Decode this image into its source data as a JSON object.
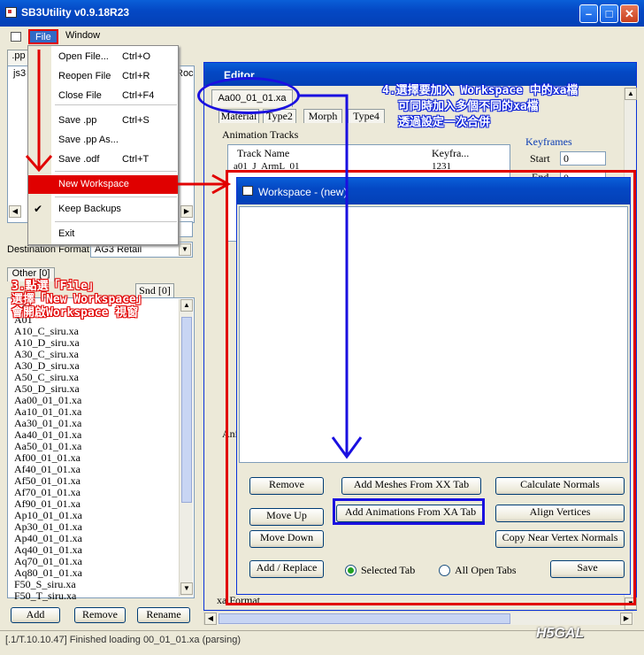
{
  "window": {
    "title": "SB3Utility v0.9.18R23"
  },
  "menubar": {
    "file": "File",
    "window": "Window"
  },
  "file_menu": {
    "items": [
      {
        "label": "Open File...",
        "shortcut": "Ctrl+O"
      },
      {
        "label": "Reopen File",
        "shortcut": "Ctrl+R"
      },
      {
        "label": "Close File",
        "shortcut": "Ctrl+F4"
      },
      {
        "label": "Save .pp",
        "shortcut": "Ctrl+S"
      },
      {
        "label": "Save .pp As...",
        "shortcut": ""
      },
      {
        "label": "Save .odf",
        "shortcut": "Ctrl+T"
      },
      {
        "label": "New Workspace",
        "shortcut": ""
      },
      {
        "label": "Keep Backups",
        "shortcut": ""
      },
      {
        "label": "Exit",
        "shortcut": ""
      }
    ]
  },
  "left_panel": {
    "top_tab": ".pp",
    "top_text": "js3",
    "side_text": "Roc",
    "dest_format_label": "Destination Format",
    "dest_format_value": "AG3 Retail",
    "tabs": [
      "Other [0]",
      "Snd [0]"
    ],
    "files": [
      "A00",
      "A01",
      "A10_C_siru.xa",
      "A10_D_siru.xa",
      "A30_C_siru.xa",
      "A30_D_siru.xa",
      "A50_C_siru.xa",
      "A50_D_siru.xa",
      "Aa00_01_01.xa",
      "Aa10_01_01.xa",
      "Aa30_01_01.xa",
      "Aa40_01_01.xa",
      "Aa50_01_01.xa",
      "Af00_01_01.xa",
      "Af40_01_01.xa",
      "Af50_01_01.xa",
      "Af70_01_01.xa",
      "Af90_01_01.xa",
      "Ap10_01_01.xa",
      "Ap30_01_01.xa",
      "Ap40_01_01.xa",
      "Aq40_01_01.xa",
      "Aq70_01_01.xa",
      "Aq80_01_01.xa",
      "F50_S_siru.xa",
      "F50_T_siru.xa"
    ],
    "buttons": {
      "add": "Add",
      "remove": "Remove",
      "rename": "Rename"
    },
    "status": "[.1/T.10.10.47] Finished loading  00_01_01.xa  (parsing)"
  },
  "editor": {
    "title": "Editor",
    "file_tab": "Aa00_01_01.xa",
    "tabs": [
      "Material",
      "Type2",
      "Morph",
      "Type4"
    ],
    "anim_tracks_label": "Animation Tracks",
    "col_track": "Track Name",
    "col_keyframes": "Keyfra...",
    "keyframes_label": "Keyframes",
    "start_label": "Start",
    "start_value": "0",
    "end_label": "End",
    "end_value": "0",
    "row1": "a01_J_ArmL_01",
    "row1_val": "1231",
    "xa_format_label": "xa Format",
    "ani_label": "Ani"
  },
  "workspace": {
    "title": "Workspace - (new)",
    "buttons": {
      "remove": "Remove",
      "move_up": "Move Up",
      "move_down": "Move Down",
      "add_replace": "Add / Replace",
      "add_meshes": "Add Meshes From XX Tab",
      "add_animations": "Add Animations From XA Tab",
      "calc_normals": "Calculate Normals",
      "align_vertices": "Align Vertices",
      "copy_normals": "Copy Near Vertex Normals",
      "save": "Save"
    },
    "radio_selected": "Selected Tab",
    "radio_all": "All Open Tabs"
  },
  "annotations": {
    "step3": [
      "3.點選「File」",
      "選擇「New Workspace」",
      "會開啟Workspace 視窗"
    ],
    "step4": [
      "4.選擇要加入 Workspace 中的xa檔",
      "可同時加入多個不同的xa檔",
      "透過設定一次合併"
    ]
  },
  "watermark": "H5GAL",
  "colors": {
    "annot_red": "#e10000",
    "annot_blue": "#0a1fd8",
    "menu_highlight": "#e00000"
  }
}
